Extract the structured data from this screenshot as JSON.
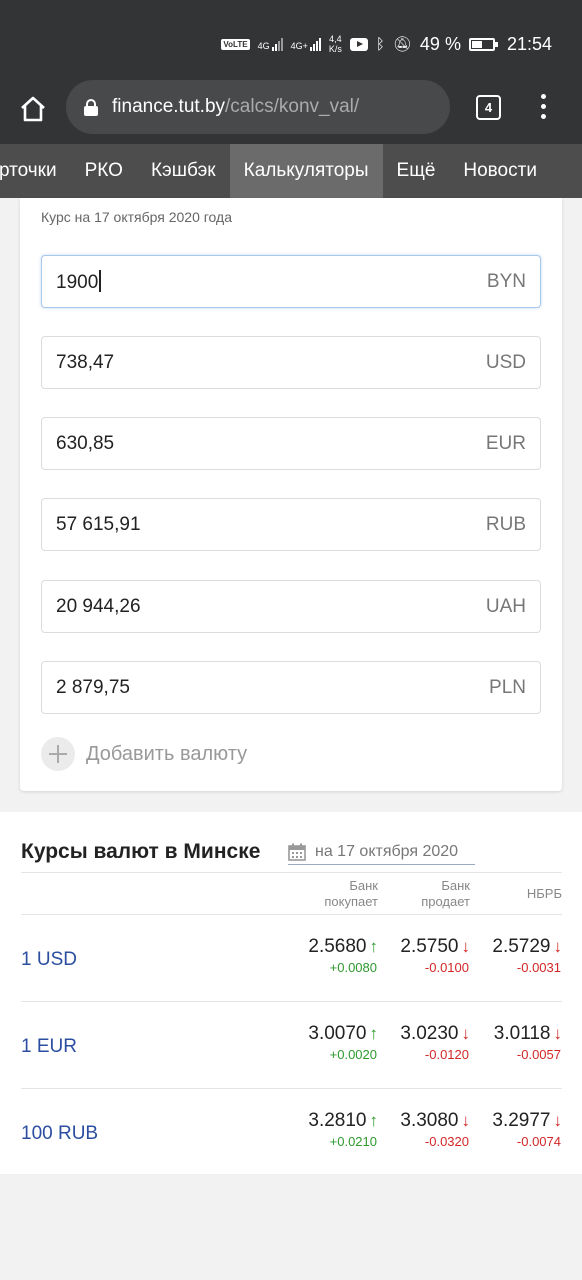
{
  "status_bar": {
    "volte": "VoLTE",
    "net1": "4G",
    "net2": "4G+",
    "speed_value": "4,4",
    "speed_unit": "K/s",
    "battery": "49 %",
    "time": "21:54"
  },
  "browser": {
    "url_domain": "finance.tut.by",
    "url_path": "/calcs/konv_val/",
    "tab_count": "4"
  },
  "nav": {
    "items": [
      {
        "label": "Карточки",
        "visible": "рточки"
      },
      {
        "label": "РКО",
        "visible": "РКО"
      },
      {
        "label": "Кэшбэк",
        "visible": "Кэшбэк"
      },
      {
        "label": "Калькуляторы",
        "visible": "Калькуляторы",
        "active": true
      },
      {
        "label": "Ещё",
        "visible": "Ещё"
      },
      {
        "label": "Новости",
        "visible": "Новости"
      }
    ]
  },
  "converter": {
    "rate_date": "Курс на 17 октября 2020 года",
    "fields": [
      {
        "value": "1900",
        "currency": "BYN"
      },
      {
        "value": "738,47",
        "currency": "USD"
      },
      {
        "value": "630,85",
        "currency": "EUR"
      },
      {
        "value": "57 615,91",
        "currency": "RUB"
      },
      {
        "value": "20 944,26",
        "currency": "UAH"
      },
      {
        "value": "2 879,75",
        "currency": "PLN"
      }
    ],
    "add_currency": "Добавить валюту"
  },
  "rates": {
    "title": "Курсы валют в Минске",
    "date": "на 17 октября 2020",
    "headers": {
      "buy": [
        "Банк",
        "покупает"
      ],
      "sell": [
        "Банк",
        "продает"
      ],
      "nbrb": "НБРБ"
    },
    "rows": [
      {
        "label": "1 USD",
        "buy": {
          "value": "2.5680",
          "dir": "up",
          "change": "+0.0080"
        },
        "sell": {
          "value": "2.5750",
          "dir": "down",
          "change": "-0.0100"
        },
        "nbrb": {
          "value": "2.5729",
          "dir": "down",
          "change": "-0.0031"
        }
      },
      {
        "label": "1 EUR",
        "buy": {
          "value": "3.0070",
          "dir": "up",
          "change": "+0.0020"
        },
        "sell": {
          "value": "3.0230",
          "dir": "down",
          "change": "-0.0120"
        },
        "nbrb": {
          "value": "3.0118",
          "dir": "down",
          "change": "-0.0057"
        }
      },
      {
        "label": "100 RUB",
        "buy": {
          "value": "3.2810",
          "dir": "up",
          "change": "+0.0210"
        },
        "sell": {
          "value": "3.3080",
          "dir": "down",
          "change": "-0.0320"
        },
        "nbrb": {
          "value": "3.2977",
          "dir": "down",
          "change": "-0.0074"
        }
      }
    ]
  },
  "colors": {
    "up": "#2e9a2e",
    "down": "#d32727",
    "link": "#2b4ea0"
  }
}
